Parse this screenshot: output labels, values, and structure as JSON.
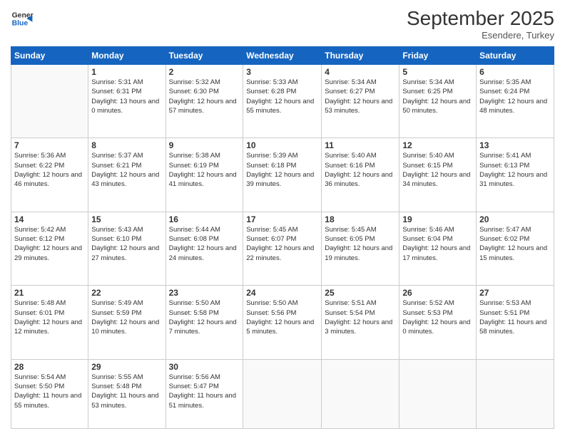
{
  "header": {
    "logo_line1": "General",
    "logo_line2": "Blue",
    "month_title": "September 2025",
    "location": "Esendere, Turkey"
  },
  "weekdays": [
    "Sunday",
    "Monday",
    "Tuesday",
    "Wednesday",
    "Thursday",
    "Friday",
    "Saturday"
  ],
  "weeks": [
    [
      {
        "day": "",
        "sunrise": "",
        "sunset": "",
        "daylight": ""
      },
      {
        "day": "1",
        "sunrise": "Sunrise: 5:31 AM",
        "sunset": "Sunset: 6:31 PM",
        "daylight": "Daylight: 13 hours and 0 minutes."
      },
      {
        "day": "2",
        "sunrise": "Sunrise: 5:32 AM",
        "sunset": "Sunset: 6:30 PM",
        "daylight": "Daylight: 12 hours and 57 minutes."
      },
      {
        "day": "3",
        "sunrise": "Sunrise: 5:33 AM",
        "sunset": "Sunset: 6:28 PM",
        "daylight": "Daylight: 12 hours and 55 minutes."
      },
      {
        "day": "4",
        "sunrise": "Sunrise: 5:34 AM",
        "sunset": "Sunset: 6:27 PM",
        "daylight": "Daylight: 12 hours and 53 minutes."
      },
      {
        "day": "5",
        "sunrise": "Sunrise: 5:34 AM",
        "sunset": "Sunset: 6:25 PM",
        "daylight": "Daylight: 12 hours and 50 minutes."
      },
      {
        "day": "6",
        "sunrise": "Sunrise: 5:35 AM",
        "sunset": "Sunset: 6:24 PM",
        "daylight": "Daylight: 12 hours and 48 minutes."
      }
    ],
    [
      {
        "day": "7",
        "sunrise": "Sunrise: 5:36 AM",
        "sunset": "Sunset: 6:22 PM",
        "daylight": "Daylight: 12 hours and 46 minutes."
      },
      {
        "day": "8",
        "sunrise": "Sunrise: 5:37 AM",
        "sunset": "Sunset: 6:21 PM",
        "daylight": "Daylight: 12 hours and 43 minutes."
      },
      {
        "day": "9",
        "sunrise": "Sunrise: 5:38 AM",
        "sunset": "Sunset: 6:19 PM",
        "daylight": "Daylight: 12 hours and 41 minutes."
      },
      {
        "day": "10",
        "sunrise": "Sunrise: 5:39 AM",
        "sunset": "Sunset: 6:18 PM",
        "daylight": "Daylight: 12 hours and 39 minutes."
      },
      {
        "day": "11",
        "sunrise": "Sunrise: 5:40 AM",
        "sunset": "Sunset: 6:16 PM",
        "daylight": "Daylight: 12 hours and 36 minutes."
      },
      {
        "day": "12",
        "sunrise": "Sunrise: 5:40 AM",
        "sunset": "Sunset: 6:15 PM",
        "daylight": "Daylight: 12 hours and 34 minutes."
      },
      {
        "day": "13",
        "sunrise": "Sunrise: 5:41 AM",
        "sunset": "Sunset: 6:13 PM",
        "daylight": "Daylight: 12 hours and 31 minutes."
      }
    ],
    [
      {
        "day": "14",
        "sunrise": "Sunrise: 5:42 AM",
        "sunset": "Sunset: 6:12 PM",
        "daylight": "Daylight: 12 hours and 29 minutes."
      },
      {
        "day": "15",
        "sunrise": "Sunrise: 5:43 AM",
        "sunset": "Sunset: 6:10 PM",
        "daylight": "Daylight: 12 hours and 27 minutes."
      },
      {
        "day": "16",
        "sunrise": "Sunrise: 5:44 AM",
        "sunset": "Sunset: 6:08 PM",
        "daylight": "Daylight: 12 hours and 24 minutes."
      },
      {
        "day": "17",
        "sunrise": "Sunrise: 5:45 AM",
        "sunset": "Sunset: 6:07 PM",
        "daylight": "Daylight: 12 hours and 22 minutes."
      },
      {
        "day": "18",
        "sunrise": "Sunrise: 5:45 AM",
        "sunset": "Sunset: 6:05 PM",
        "daylight": "Daylight: 12 hours and 19 minutes."
      },
      {
        "day": "19",
        "sunrise": "Sunrise: 5:46 AM",
        "sunset": "Sunset: 6:04 PM",
        "daylight": "Daylight: 12 hours and 17 minutes."
      },
      {
        "day": "20",
        "sunrise": "Sunrise: 5:47 AM",
        "sunset": "Sunset: 6:02 PM",
        "daylight": "Daylight: 12 hours and 15 minutes."
      }
    ],
    [
      {
        "day": "21",
        "sunrise": "Sunrise: 5:48 AM",
        "sunset": "Sunset: 6:01 PM",
        "daylight": "Daylight: 12 hours and 12 minutes."
      },
      {
        "day": "22",
        "sunrise": "Sunrise: 5:49 AM",
        "sunset": "Sunset: 5:59 PM",
        "daylight": "Daylight: 12 hours and 10 minutes."
      },
      {
        "day": "23",
        "sunrise": "Sunrise: 5:50 AM",
        "sunset": "Sunset: 5:58 PM",
        "daylight": "Daylight: 12 hours and 7 minutes."
      },
      {
        "day": "24",
        "sunrise": "Sunrise: 5:50 AM",
        "sunset": "Sunset: 5:56 PM",
        "daylight": "Daylight: 12 hours and 5 minutes."
      },
      {
        "day": "25",
        "sunrise": "Sunrise: 5:51 AM",
        "sunset": "Sunset: 5:54 PM",
        "daylight": "Daylight: 12 hours and 3 minutes."
      },
      {
        "day": "26",
        "sunrise": "Sunrise: 5:52 AM",
        "sunset": "Sunset: 5:53 PM",
        "daylight": "Daylight: 12 hours and 0 minutes."
      },
      {
        "day": "27",
        "sunrise": "Sunrise: 5:53 AM",
        "sunset": "Sunset: 5:51 PM",
        "daylight": "Daylight: 11 hours and 58 minutes."
      }
    ],
    [
      {
        "day": "28",
        "sunrise": "Sunrise: 5:54 AM",
        "sunset": "Sunset: 5:50 PM",
        "daylight": "Daylight: 11 hours and 55 minutes."
      },
      {
        "day": "29",
        "sunrise": "Sunrise: 5:55 AM",
        "sunset": "Sunset: 5:48 PM",
        "daylight": "Daylight: 11 hours and 53 minutes."
      },
      {
        "day": "30",
        "sunrise": "Sunrise: 5:56 AM",
        "sunset": "Sunset: 5:47 PM",
        "daylight": "Daylight: 11 hours and 51 minutes."
      },
      {
        "day": "",
        "sunrise": "",
        "sunset": "",
        "daylight": ""
      },
      {
        "day": "",
        "sunrise": "",
        "sunset": "",
        "daylight": ""
      },
      {
        "day": "",
        "sunrise": "",
        "sunset": "",
        "daylight": ""
      },
      {
        "day": "",
        "sunrise": "",
        "sunset": "",
        "daylight": ""
      }
    ]
  ]
}
